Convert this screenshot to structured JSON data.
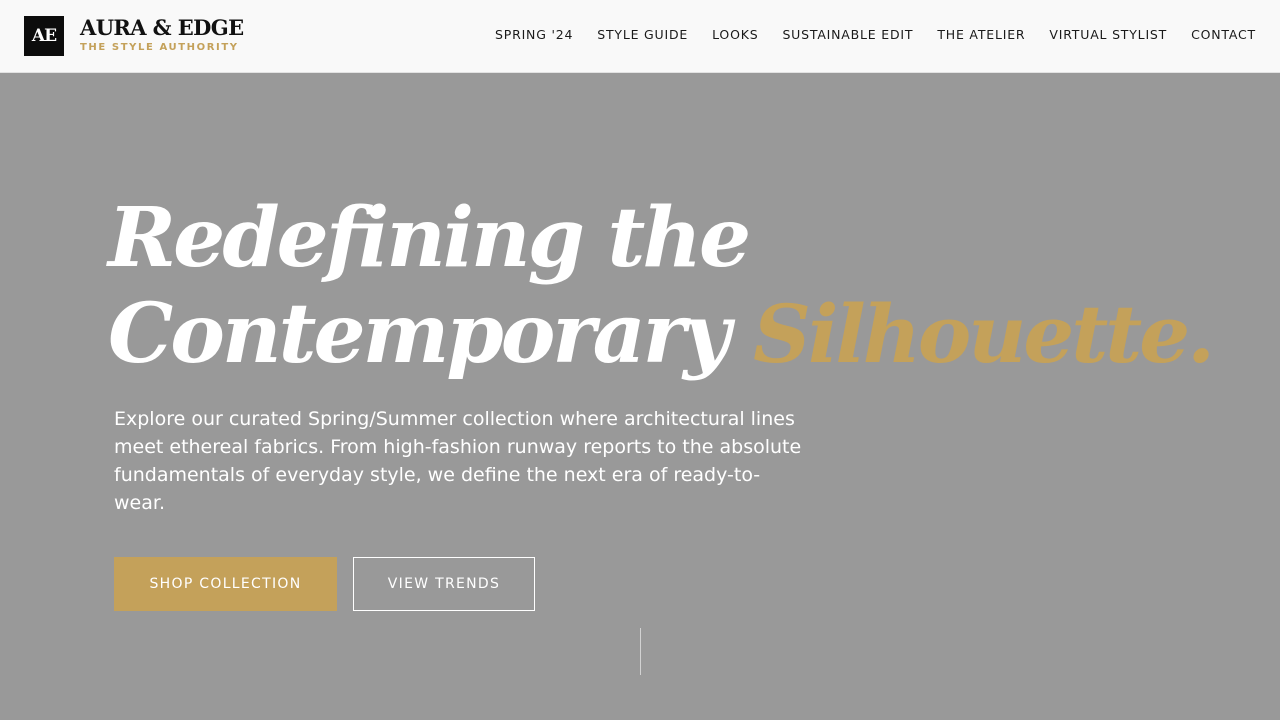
{
  "brand": {
    "monogram": "AE",
    "name": "AURA & EDGE",
    "tagline": "THE STYLE AUTHORITY"
  },
  "nav": {
    "items": [
      {
        "label": "SPRING '24"
      },
      {
        "label": "STYLE GUIDE"
      },
      {
        "label": "LOOKS"
      },
      {
        "label": "SUSTAINABLE EDIT"
      },
      {
        "label": "THE ATELIER"
      },
      {
        "label": "VIRTUAL STYLIST"
      },
      {
        "label": "CONTACT"
      }
    ]
  },
  "hero": {
    "title_line1": "Redefining the",
    "title_line2": "Contemporary",
    "title_accent": "Silhouette.",
    "description": "Explore our curated Spring/Summer collection where architectural lines meet ethereal fabrics. From high-fashion runway reports to the absolute fundamentals of everyday style, we define the next era of ready-to-wear.",
    "primary_cta": "SHOP COLLECTION",
    "secondary_cta": "VIEW TRENDS"
  },
  "colors": {
    "accent_gold": "#c4a15a",
    "hero_background": "#999999",
    "header_background": "#f9f9f9",
    "logo_background": "#0c0c0c"
  }
}
